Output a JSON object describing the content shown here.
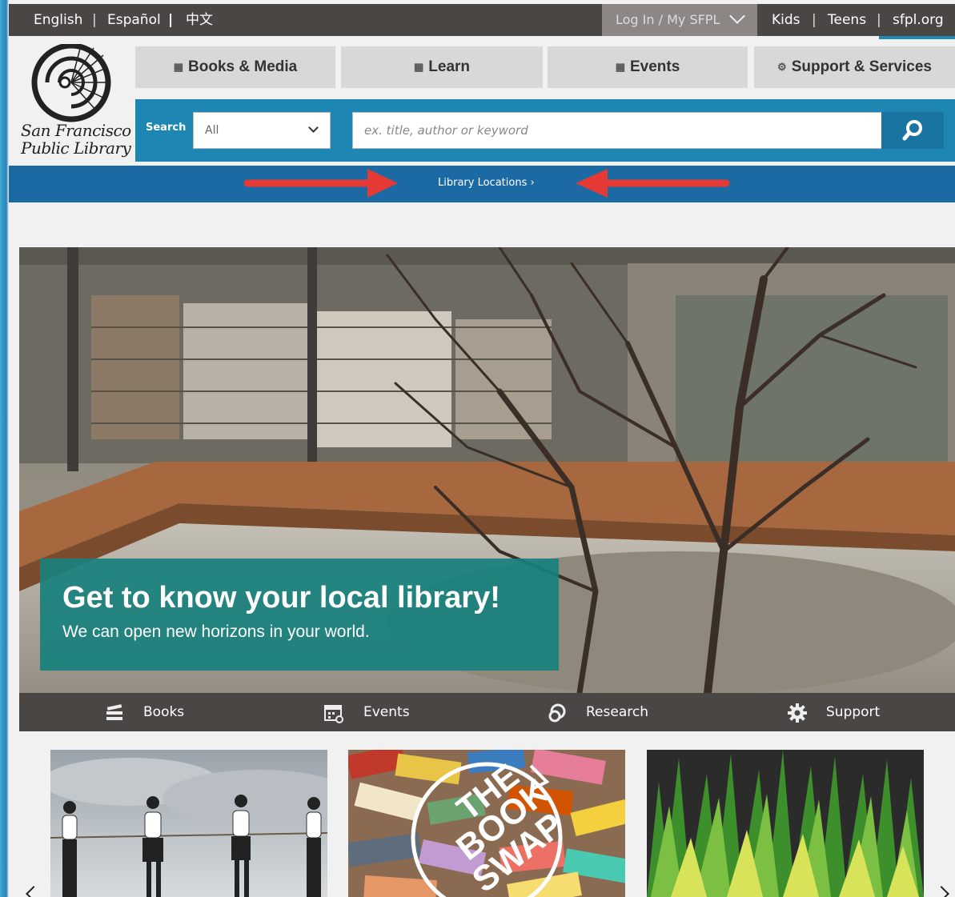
{
  "topbar": {
    "languages": [
      "English",
      "Español",
      "中文"
    ],
    "login": "Log In / My SFPL",
    "right_links": [
      "Kids",
      "Teens",
      "sfpl.org"
    ]
  },
  "logo": {
    "line1": "San Francisco",
    "line2": "Public Library"
  },
  "nav": {
    "tabs": [
      {
        "label": "Books & Media",
        "icon": "book-media-icon"
      },
      {
        "label": "Learn",
        "icon": "learn-icon"
      },
      {
        "label": "Events",
        "icon": "events-icon"
      },
      {
        "label": "Support & Services",
        "icon": "gear-icon"
      }
    ]
  },
  "search": {
    "label": "Search",
    "scope": "All",
    "placeholder": "ex. title, author or keyword"
  },
  "locations": {
    "label": "Library Locations"
  },
  "hero": {
    "title": "Get to know your local library!",
    "subtitle": "We can open new horizons in your world."
  },
  "quick_links": [
    {
      "label": "Books",
      "icon": "books-icon"
    },
    {
      "label": "Events",
      "icon": "calendar-icon"
    },
    {
      "label": "Research",
      "icon": "research-icon"
    },
    {
      "label": "Support",
      "icon": "gear-icon"
    }
  ],
  "colors": {
    "topbar": "#4a4644",
    "nav_tab": "#d8d8d8",
    "search_strip": "#1e86b2",
    "locations_bar": "#1c6aa3",
    "hero_caption": "#18807c",
    "annotation_arrow": "#e53935"
  }
}
